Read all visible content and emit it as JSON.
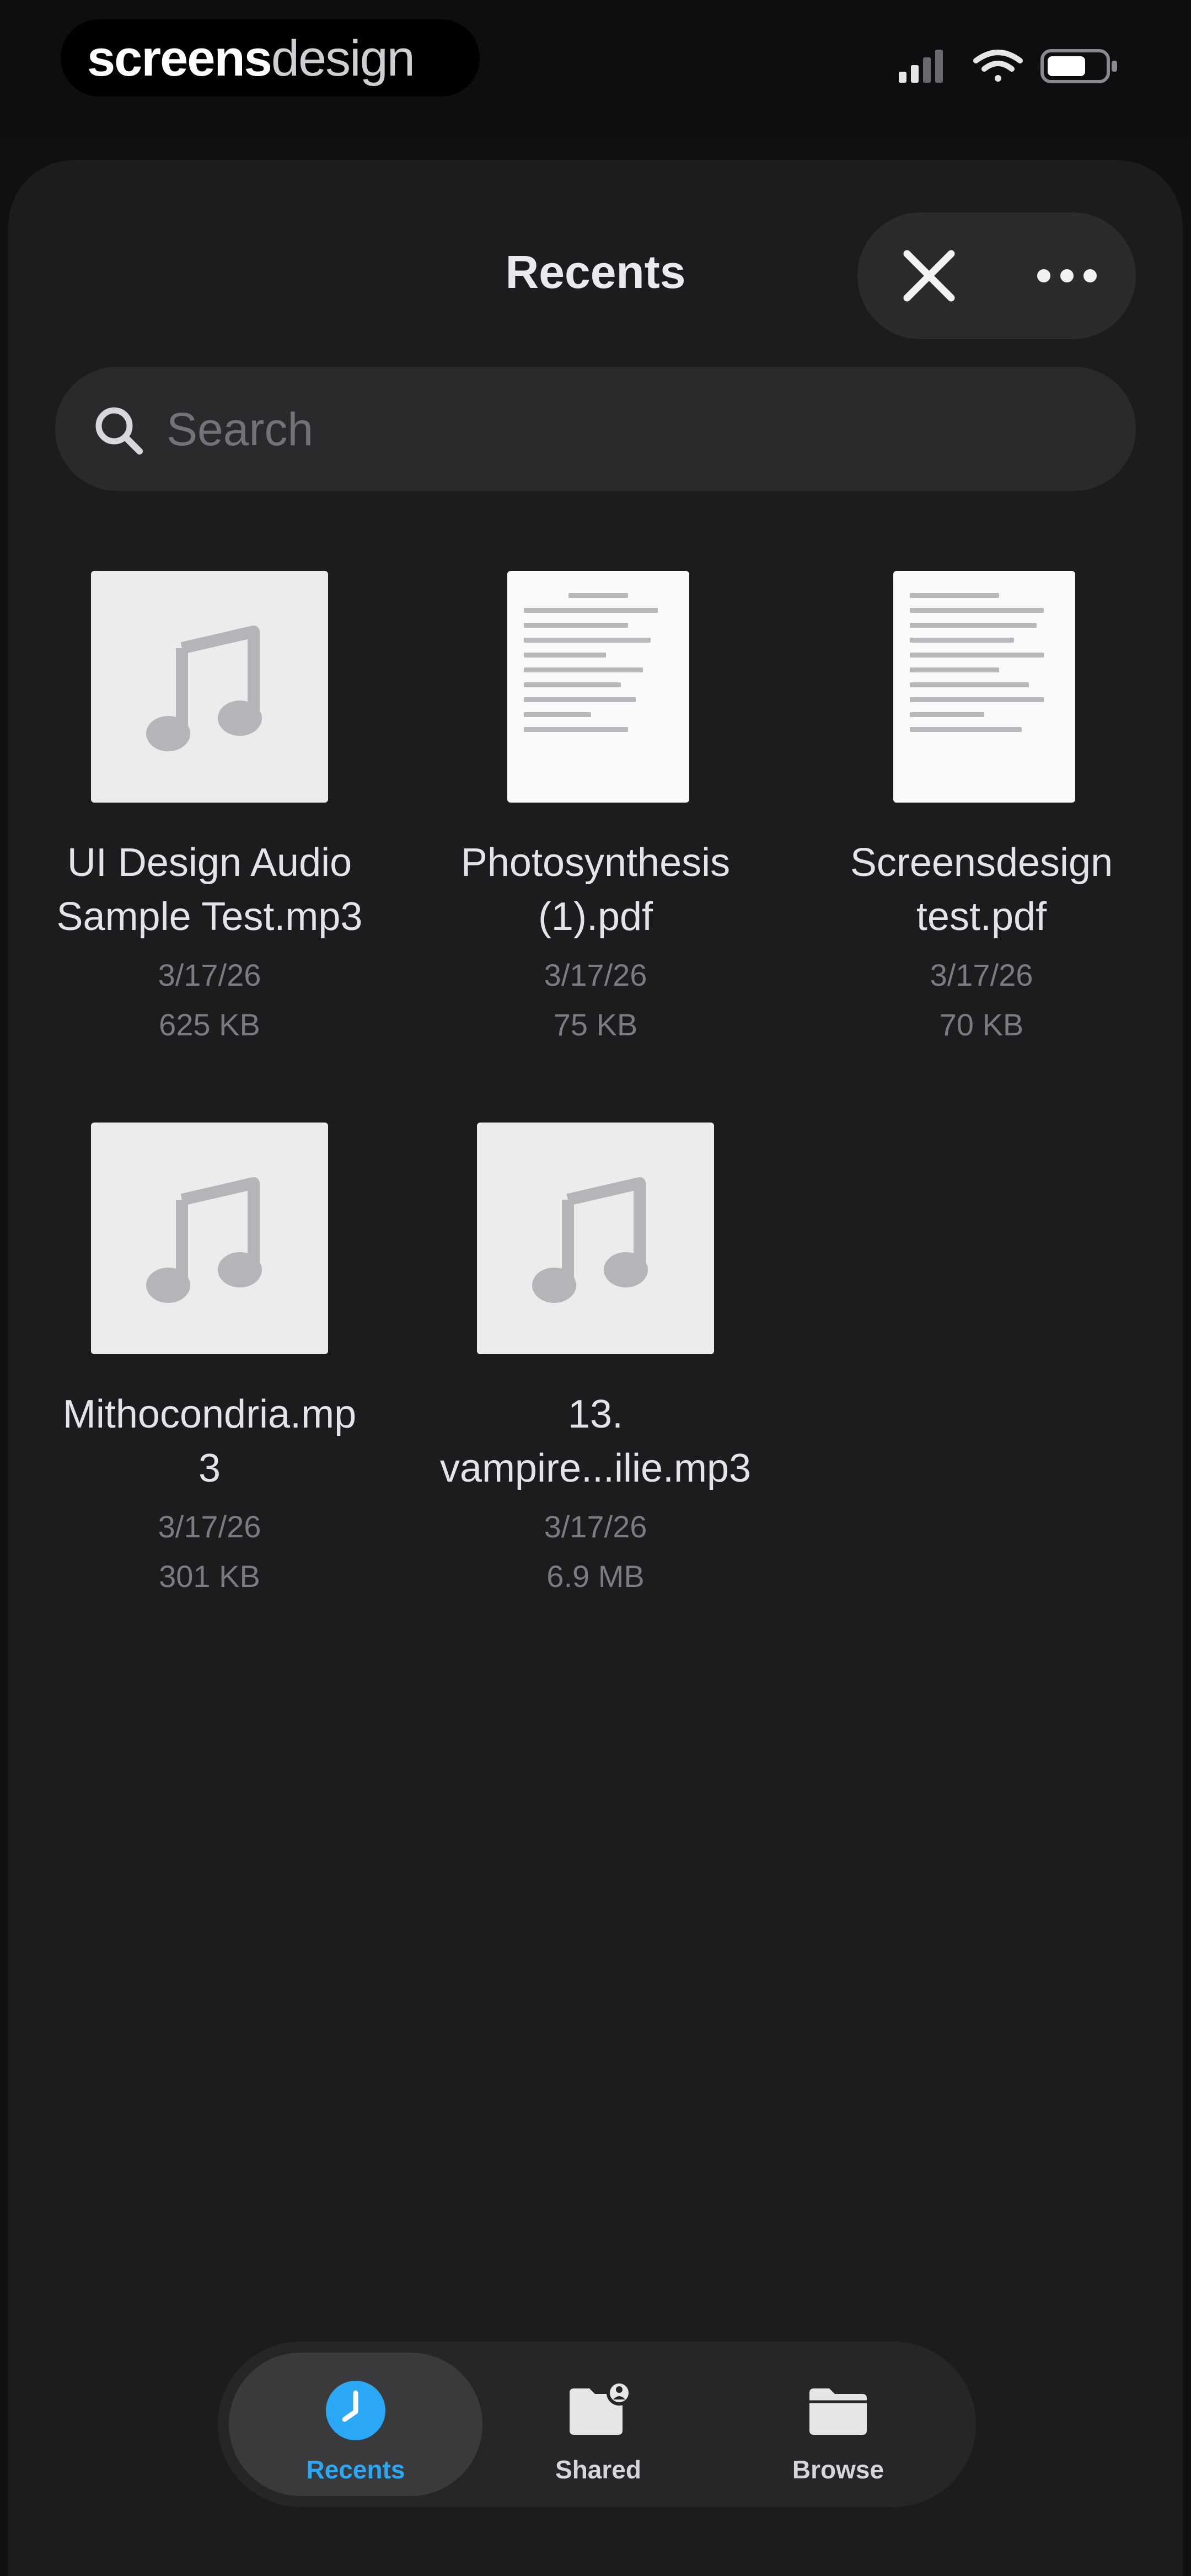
{
  "status_bar": {
    "brand_bold": "screens",
    "brand_light": "design"
  },
  "sheet": {
    "title": "Recents"
  },
  "search": {
    "placeholder": "Search"
  },
  "files": [
    {
      "type": "audio",
      "name_line1": "UI Design Audio",
      "name_line2": "Sample Test.mp3",
      "date": "3/17/26",
      "size": "625 KB"
    },
    {
      "type": "document",
      "name_line1": "Photosynthesis",
      "name_line2": "(1).pdf",
      "date": "3/17/26",
      "size": "75 KB"
    },
    {
      "type": "document",
      "name_line1": "Screensdesign",
      "name_line2": "test.pdf",
      "date": "3/17/26",
      "size": "70 KB"
    },
    {
      "type": "audio",
      "name_line1": "Mithocondria.mp",
      "name_line2": "3",
      "date": "3/17/26",
      "size": "301 KB"
    },
    {
      "type": "audio",
      "name_line1": "13.",
      "name_line2": "vampire...ilie.mp3",
      "date": "3/17/26",
      "size": "6.9 MB"
    }
  ],
  "tabs": [
    {
      "label": "Recents",
      "icon": "clock-icon",
      "active": true
    },
    {
      "label": "Shared",
      "icon": "shared-folder-icon",
      "active": false
    },
    {
      "label": "Browse",
      "icon": "folder-icon",
      "active": false
    }
  ],
  "colors": {
    "background": "#101012",
    "sheet": "#1c1c1e",
    "accent": "#2aa8f5",
    "text_secondary": "#7b7b80"
  }
}
